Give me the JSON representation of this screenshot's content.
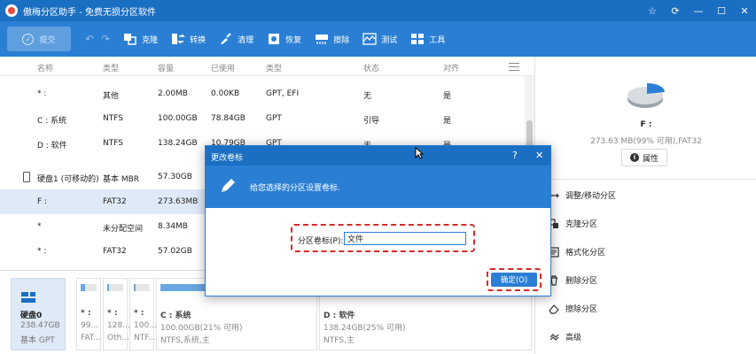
{
  "window": {
    "title": "傲梅分区助手 - 免费无损分区软件",
    "controls": [
      "☆",
      "⟳",
      "—",
      "☐",
      "✕"
    ]
  },
  "toolbar": {
    "commit_label": "提交",
    "items": [
      {
        "label": "克隆",
        "icon": "clone-icon"
      },
      {
        "label": "转换",
        "icon": "convert-icon"
      },
      {
        "label": "清理",
        "icon": "clean-icon"
      },
      {
        "label": "恢复",
        "icon": "recover-icon"
      },
      {
        "label": "擦除",
        "icon": "wipe-icon"
      },
      {
        "label": "测试",
        "icon": "test-icon"
      },
      {
        "label": "工具",
        "icon": "tools-icon"
      }
    ]
  },
  "table": {
    "headers": [
      "名称",
      "类型",
      "容量",
      "已使用",
      "类型",
      "状态",
      "对齐"
    ],
    "rows": [
      {
        "name": "* :",
        "type": "其他",
        "capacity": "2.00MB",
        "used": "0.00KB",
        "fs": "GPT, EFI",
        "status": "无",
        "align": "是"
      },
      {
        "name": "C : 系统",
        "type": "NTFS",
        "capacity": "100.00GB",
        "used": "78.84GB",
        "fs": "GPT",
        "status": "引导",
        "align": "是"
      },
      {
        "name": "D : 软件",
        "type": "NTFS",
        "capacity": "138.24GB",
        "used": "10.79GB",
        "fs": "GPT",
        "status": "无",
        "align": "是"
      },
      {
        "name": "硬盘1 (可移动的)",
        "type": "基本 MBR",
        "capacity": "57.30GB",
        "used": "",
        "fs": "",
        "status": "",
        "align": ""
      },
      {
        "name": "F :",
        "type": "FAT32",
        "capacity": "273.63MB",
        "used": "",
        "fs": "",
        "status": "",
        "align": ""
      },
      {
        "name": "*",
        "type": "未分配空间",
        "capacity": "8.34MB",
        "used": "",
        "fs": "",
        "status": "",
        "align": ""
      },
      {
        "name": "* :",
        "type": "FAT32",
        "capacity": "57.02GB",
        "used": "",
        "fs": "",
        "status": "",
        "align": ""
      }
    ]
  },
  "diskmap": {
    "disk": {
      "name": "硬盘0",
      "size": "238.47GB",
      "type": "基本 GPT"
    },
    "partitions": [
      {
        "label": "* :",
        "l2": "99...",
        "l3": "FAT...",
        "fill": 0.3
      },
      {
        "label": "* :",
        "l2": "128...",
        "l3": "Oth...",
        "fill": 0.1
      },
      {
        "label": "* :",
        "l2": "100...",
        "l3": "NTF...",
        "fill": 0.1
      },
      {
        "label": "C : 系统",
        "l2": "100.00GB(21% 可用)",
        "l3": "NTFS,系统,主",
        "fill": 0.79
      },
      {
        "label": "D : 软件",
        "l2": "138.24GB(25% 可用)",
        "l3": "NTFS,主",
        "fill": 0.75
      }
    ]
  },
  "rpanel": {
    "name": "F :",
    "info": "273.63 MB(99% 可用),FAT32",
    "prop_label": "属性",
    "pie_used_fraction": 0.01,
    "actions": [
      {
        "label": "调整/移动分区",
        "icon": "resize-icon"
      },
      {
        "label": "克隆分区",
        "icon": "clone-partition-icon"
      },
      {
        "label": "格式化分区",
        "icon": "format-icon"
      },
      {
        "label": "删除分区",
        "icon": "delete-icon"
      },
      {
        "label": "擦除分区",
        "icon": "erase-icon"
      },
      {
        "label": "高级",
        "icon": "advanced-icon"
      }
    ]
  },
  "dialog": {
    "title": "更改卷标",
    "help": "?",
    "close": "✕",
    "message": "给您选择的分区设置卷标.",
    "field_label": "分区卷标(P):",
    "field_value": "文件",
    "ok_label": "确定(O)"
  }
}
